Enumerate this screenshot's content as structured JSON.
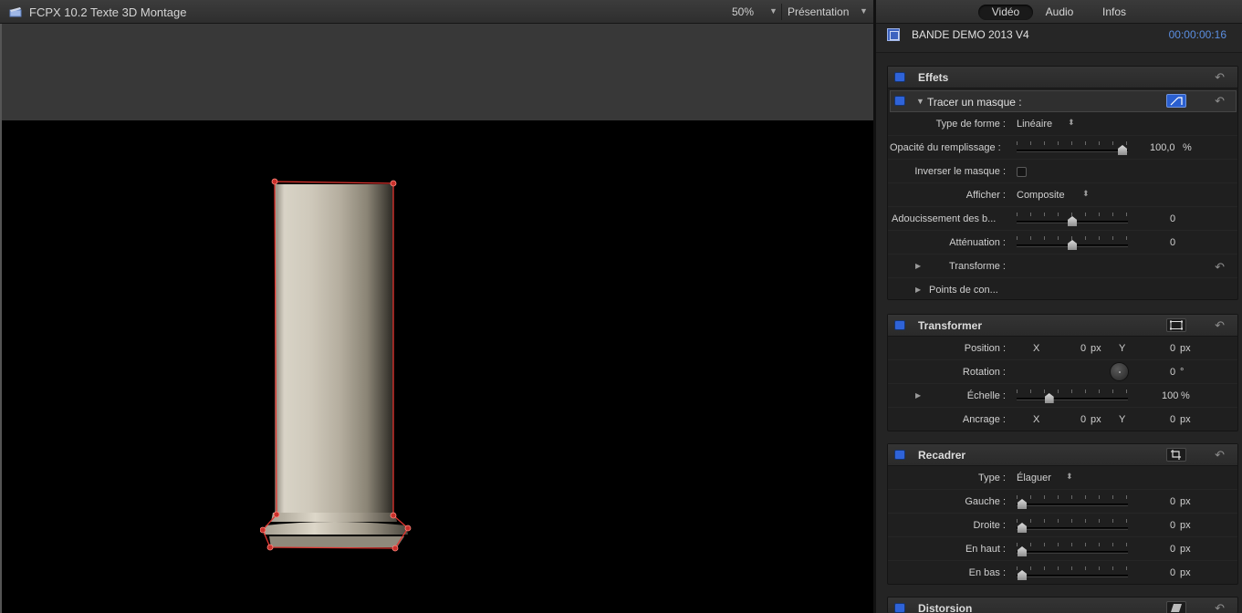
{
  "viewer": {
    "title": "FCPX 10.2 Texte 3D Montage",
    "zoom": "50%",
    "view_menu": "Présentation"
  },
  "inspector": {
    "tabs": [
      "Vidéo",
      "Audio",
      "Infos"
    ],
    "active_tab": "Vidéo",
    "clip_name": "BANDE DEMO 2013 V4",
    "timecode": "00:00:00:16",
    "effets": {
      "title": "Effets",
      "effect_title": "Tracer un masque :",
      "shape_type_label": "Type de forme :",
      "shape_type_value": "Linéaire",
      "fill_opacity_label": "Opacité du remplissage :",
      "fill_opacity_value": "100,0",
      "fill_opacity_unit": "%",
      "fill_opacity_level": 1.0,
      "invert_label": "Inverser le masque :",
      "invert_checked": false,
      "display_label": "Afficher :",
      "display_value": "Composite",
      "softness_label": "Adoucissement des b...",
      "softness_value": "0",
      "softness_level": 0.5,
      "falloff_label": "Atténuation :",
      "falloff_value": "0",
      "falloff_level": 0.5,
      "transform_label": "Transforme :",
      "control_points_label": "Points de con..."
    },
    "transformer": {
      "title": "Transformer",
      "position_label": "Position :",
      "position_x_axis": "X",
      "position_x": "0",
      "position_y_axis": "Y",
      "position_y": "0",
      "unit_px": "px",
      "rotation_label": "Rotation :",
      "rotation_value": "0",
      "rotation_unit": "°",
      "scale_label": "Échelle :",
      "scale_value": "100",
      "scale_unit": "%",
      "scale_level": 0.27,
      "anchor_label": "Ancrage :",
      "anchor_x_axis": "X",
      "anchor_x": "0",
      "anchor_y_axis": "Y",
      "anchor_y": "0"
    },
    "recadrer": {
      "title": "Recadrer",
      "type_label": "Type :",
      "type_value": "Élaguer",
      "unit_px": "px",
      "left_label": "Gauche :",
      "left_value": "0",
      "right_label": "Droite :",
      "right_value": "0",
      "top_label": "En haut :",
      "top_value": "0",
      "bottom_label": "En bas :",
      "bottom_value": "0",
      "crop_level": 0.0
    },
    "distorsion": {
      "title": "Distorsion"
    }
  },
  "colors": {
    "accent_blue": "#2f63d8",
    "timecode_blue": "#5b8ee0",
    "mask_red": "#e0342f"
  }
}
